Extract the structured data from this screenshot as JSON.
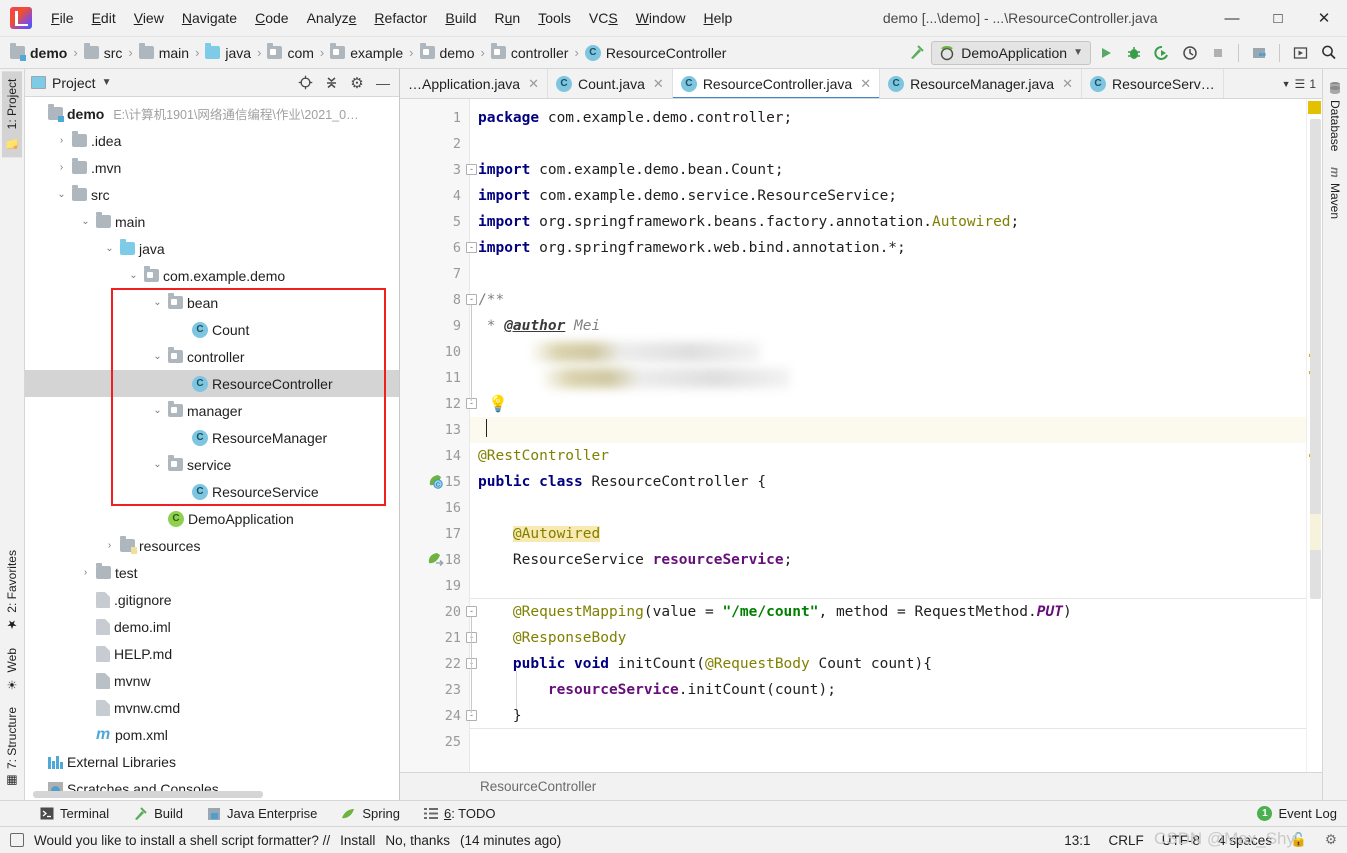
{
  "window": {
    "title": "demo [...\\demo] - ...\\ResourceController.java",
    "minimize": "—",
    "maximize": "□",
    "close": "✕",
    "logo_icon": "intellij-idea-logo"
  },
  "menu": [
    {
      "label": "File"
    },
    {
      "label": "Edit"
    },
    {
      "label": "View"
    },
    {
      "label": "Navigate"
    },
    {
      "label": "Code"
    },
    {
      "label": "Analyze"
    },
    {
      "label": "Refactor"
    },
    {
      "label": "Build"
    },
    {
      "label": "Run"
    },
    {
      "label": "Tools"
    },
    {
      "label": "VCS"
    },
    {
      "label": "Window"
    },
    {
      "label": "Help"
    }
  ],
  "navbar": {
    "breadcrumbs": [
      {
        "label": "demo",
        "icon": "project-folder-icon"
      },
      {
        "label": "src",
        "icon": "folder-icon"
      },
      {
        "label": "main",
        "icon": "folder-icon"
      },
      {
        "label": "java",
        "icon": "source-folder-icon"
      },
      {
        "label": "com",
        "icon": "package-icon"
      },
      {
        "label": "example",
        "icon": "package-icon"
      },
      {
        "label": "demo",
        "icon": "package-icon"
      },
      {
        "label": "controller",
        "icon": "package-icon"
      },
      {
        "label": "ResourceController",
        "icon": "class-icon"
      }
    ],
    "separator": "›",
    "run_config": "DemoApplication",
    "run_config_icon": "spring-boot-icon",
    "dropdown_icon": "chevron-down-icon",
    "buttons": [
      {
        "name": "make-project-button",
        "icon": "hammer-icon",
        "glyph": "↖"
      },
      {
        "name": "run-button",
        "icon": "run-icon",
        "glyph": "▶"
      },
      {
        "name": "debug-button",
        "icon": "debug-bug-icon",
        "glyph": "🐞"
      },
      {
        "name": "run-with-coverage-button",
        "icon": "coverage-icon",
        "glyph": "⮌"
      },
      {
        "name": "profile-button",
        "icon": "profiler-icon",
        "glyph": "◴"
      },
      {
        "name": "stop-button",
        "icon": "stop-square-icon",
        "glyph": "■"
      },
      {
        "name": "project-structure-button",
        "icon": "project-structure-icon",
        "glyph": "▤"
      },
      {
        "name": "updates-button",
        "icon": "update-icon",
        "glyph": "▣"
      },
      {
        "name": "search-everywhere-button",
        "icon": "search-icon",
        "glyph": "⌕"
      }
    ]
  },
  "left_strip": [
    {
      "label": "1: Project",
      "icon": "project-icon",
      "active": true
    },
    {
      "label": "2: Favorites",
      "icon": "star-icon",
      "active": false
    },
    {
      "label": "Web",
      "icon": "globe-icon",
      "active": false
    },
    {
      "label": "7: Structure",
      "icon": "structure-icon",
      "active": false
    }
  ],
  "right_strip": [
    {
      "label": "Database",
      "icon": "database-icon"
    },
    {
      "label": "Maven",
      "icon": "maven-m-icon"
    }
  ],
  "project_pane": {
    "title": "Project",
    "dropdown_icon": "chevron-down-icon",
    "actions": [
      {
        "name": "scroll-from-source-button",
        "icon": "target-icon",
        "glyph": "⊕"
      },
      {
        "name": "collapse-all-button",
        "icon": "collapse-icon",
        "glyph": "⤓"
      },
      {
        "name": "settings-button",
        "icon": "gear-icon",
        "glyph": "⚙"
      },
      {
        "name": "hide-button",
        "icon": "minimize-icon",
        "glyph": "—"
      }
    ],
    "tree": [
      {
        "label": "demo",
        "path": "E:\\计算机1901\\网络通信编程\\作业\\2021_0…",
        "indent": 0,
        "arrow": "",
        "icon": "project-folder-icon",
        "bold": true,
        "selected": false
      },
      {
        "label": ".idea",
        "path": "",
        "indent": 1,
        "arrow": "›",
        "icon": "folder-icon",
        "bold": false,
        "selected": false
      },
      {
        "label": ".mvn",
        "path": "",
        "indent": 1,
        "arrow": "›",
        "icon": "folder-icon",
        "bold": false,
        "selected": false
      },
      {
        "label": "src",
        "path": "",
        "indent": 1,
        "arrow": "⌄",
        "icon": "folder-icon",
        "bold": false,
        "selected": false
      },
      {
        "label": "main",
        "path": "",
        "indent": 2,
        "arrow": "⌄",
        "icon": "folder-icon",
        "bold": false,
        "selected": false
      },
      {
        "label": "java",
        "path": "",
        "indent": 3,
        "arrow": "⌄",
        "icon": "source-folder-icon",
        "bold": false,
        "selected": false
      },
      {
        "label": "com.example.demo",
        "path": "",
        "indent": 4,
        "arrow": "⌄",
        "icon": "package-icon",
        "bold": false,
        "selected": false
      },
      {
        "label": "bean",
        "path": "",
        "indent": 5,
        "arrow": "⌄",
        "icon": "package-icon",
        "bold": false,
        "selected": false
      },
      {
        "label": "Count",
        "path": "",
        "indent": 6,
        "arrow": "",
        "icon": "class-icon",
        "bold": false,
        "selected": false
      },
      {
        "label": "controller",
        "path": "",
        "indent": 5,
        "arrow": "⌄",
        "icon": "package-icon",
        "bold": false,
        "selected": false
      },
      {
        "label": "ResourceController",
        "path": "",
        "indent": 6,
        "arrow": "",
        "icon": "class-icon",
        "bold": false,
        "selected": true
      },
      {
        "label": "manager",
        "path": "",
        "indent": 5,
        "arrow": "⌄",
        "icon": "package-icon",
        "bold": false,
        "selected": false
      },
      {
        "label": "ResourceManager",
        "path": "",
        "indent": 6,
        "arrow": "",
        "icon": "class-icon",
        "bold": false,
        "selected": false
      },
      {
        "label": "service",
        "path": "",
        "indent": 5,
        "arrow": "⌄",
        "icon": "package-icon",
        "bold": false,
        "selected": false
      },
      {
        "label": "ResourceService",
        "path": "",
        "indent": 6,
        "arrow": "",
        "icon": "class-icon",
        "bold": false,
        "selected": false
      },
      {
        "label": "DemoApplication",
        "path": "",
        "indent": 5,
        "arrow": "",
        "icon": "spring-class-icon",
        "bold": false,
        "selected": false
      },
      {
        "label": "resources",
        "path": "",
        "indent": 3,
        "arrow": "›",
        "icon": "resources-folder-icon",
        "bold": false,
        "selected": false
      },
      {
        "label": "test",
        "path": "",
        "indent": 2,
        "arrow": "›",
        "icon": "folder-icon",
        "bold": false,
        "selected": false
      },
      {
        "label": ".gitignore",
        "path": "",
        "indent": 2,
        "arrow": "",
        "icon": "gitignore-file-icon",
        "bold": false,
        "selected": false
      },
      {
        "label": "demo.iml",
        "path": "",
        "indent": 2,
        "arrow": "",
        "icon": "iml-file-icon",
        "bold": false,
        "selected": false
      },
      {
        "label": "HELP.md",
        "path": "",
        "indent": 2,
        "arrow": "",
        "icon": "markdown-file-icon",
        "bold": false,
        "selected": false
      },
      {
        "label": "mvnw",
        "path": "",
        "indent": 2,
        "arrow": "",
        "icon": "shell-file-icon",
        "bold": false,
        "selected": false
      },
      {
        "label": "mvnw.cmd",
        "path": "",
        "indent": 2,
        "arrow": "",
        "icon": "cmd-file-icon",
        "bold": false,
        "selected": false
      },
      {
        "label": "pom.xml",
        "path": "",
        "indent": 2,
        "arrow": "",
        "icon": "maven-pom-icon",
        "bold": false,
        "selected": false
      },
      {
        "label": "External Libraries",
        "path": "",
        "indent": 0,
        "arrow": "",
        "icon": "libraries-icon",
        "bold": false,
        "selected": false
      },
      {
        "label": "Scratches and Consoles",
        "path": "",
        "indent": 0,
        "arrow": "",
        "icon": "scratches-icon",
        "bold": false,
        "selected": false
      }
    ],
    "highlight_box": {
      "first_row": 7,
      "last_row": 14,
      "color": "#f02020"
    }
  },
  "editor": {
    "tabs": [
      {
        "label": "…Application.java",
        "icon": "class-icon",
        "active": false,
        "close": "✕"
      },
      {
        "label": "Count.java",
        "icon": "class-icon",
        "active": false,
        "close": "✕"
      },
      {
        "label": "ResourceController.java",
        "icon": "class-icon",
        "active": true,
        "close": "✕"
      },
      {
        "label": "ResourceManager.java",
        "icon": "class-icon",
        "active": false,
        "close": "✕"
      },
      {
        "label": "ResourceServ…",
        "icon": "class-icon",
        "active": false,
        "close": ""
      }
    ],
    "tab_overflow": "1",
    "tab_overflow_icon": "tab-list-icon",
    "breadcrumb_bottom": "ResourceController",
    "lines": [
      {
        "n": 1,
        "tokens": [
          {
            "t": "package",
            "c": "kw"
          },
          {
            "t": " com.example.demo.controller;",
            "c": "plain"
          }
        ]
      },
      {
        "n": 2,
        "tokens": []
      },
      {
        "n": 3,
        "tokens": [
          {
            "t": "import",
            "c": "kw"
          },
          {
            "t": " com.example.demo.bean.Count;",
            "c": "plain"
          }
        ]
      },
      {
        "n": 4,
        "tokens": [
          {
            "t": "import",
            "c": "kw"
          },
          {
            "t": " com.example.demo.service.ResourceService;",
            "c": "plain"
          }
        ]
      },
      {
        "n": 5,
        "tokens": [
          {
            "t": "import",
            "c": "kw"
          },
          {
            "t": " org.springframework.beans.factory.annotation.",
            "c": "plain"
          },
          {
            "t": "Autowired",
            "c": "ann"
          },
          {
            "t": ";",
            "c": "plain"
          }
        ]
      },
      {
        "n": 6,
        "tokens": [
          {
            "t": "import",
            "c": "kw"
          },
          {
            "t": " org.springframework.web.bind.annotation.*;",
            "c": "plain"
          }
        ]
      },
      {
        "n": 7,
        "tokens": []
      },
      {
        "n": 8,
        "tokens": [
          {
            "t": "/**",
            "c": "cmt"
          }
        ]
      },
      {
        "n": 9,
        "tokens": [
          {
            "t": " * ",
            "c": "cmt"
          },
          {
            "t": "@author",
            "c": "cmt-tag"
          },
          {
            "t": " Mei",
            "c": "cmt-val"
          }
        ]
      },
      {
        "n": 10,
        "tokens": [],
        "redacted": true
      },
      {
        "n": 11,
        "tokens": [],
        "redacted": true
      },
      {
        "n": 12,
        "tokens": [],
        "bulb": true
      },
      {
        "n": 13,
        "tokens": [],
        "cursor": true
      },
      {
        "n": 14,
        "tokens": [
          {
            "t": "@RestController",
            "c": "ann"
          }
        ]
      },
      {
        "n": 15,
        "tokens": [
          {
            "t": "public class",
            "c": "kw"
          },
          {
            "t": " ResourceController {",
            "c": "plain"
          }
        ]
      },
      {
        "n": 16,
        "tokens": []
      },
      {
        "n": 17,
        "tokens": [
          {
            "t": "    ",
            "c": "plain"
          },
          {
            "t": "@Autowired",
            "c": "ann hl-aw"
          }
        ]
      },
      {
        "n": 18,
        "tokens": [
          {
            "t": "    ResourceService ",
            "c": "plain"
          },
          {
            "t": "resourceService",
            "c": "fld"
          },
          {
            "t": ";",
            "c": "plain"
          }
        ]
      },
      {
        "n": 19,
        "tokens": []
      },
      {
        "n": 20,
        "tokens": [
          {
            "t": "    ",
            "c": "plain"
          },
          {
            "t": "@RequestMapping",
            "c": "ann"
          },
          {
            "t": "(value = ",
            "c": "plain"
          },
          {
            "t": "\"/me/count\"",
            "c": "str"
          },
          {
            "t": ", method = RequestMethod.",
            "c": "plain"
          },
          {
            "t": "PUT",
            "c": "stat"
          },
          {
            "t": ")",
            "c": "plain"
          }
        ]
      },
      {
        "n": 21,
        "tokens": [
          {
            "t": "    ",
            "c": "plain"
          },
          {
            "t": "@ResponseBody",
            "c": "ann"
          }
        ]
      },
      {
        "n": 22,
        "tokens": [
          {
            "t": "    ",
            "c": "plain"
          },
          {
            "t": "public void",
            "c": "kw"
          },
          {
            "t": " initCount(",
            "c": "plain"
          },
          {
            "t": "@RequestBody",
            "c": "ann"
          },
          {
            "t": " Count count){",
            "c": "plain"
          }
        ]
      },
      {
        "n": 23,
        "tokens": [
          {
            "t": "        ",
            "c": "plain"
          },
          {
            "t": "resourceService",
            "c": "fld"
          },
          {
            "t": ".initCount(count);",
            "c": "plain"
          }
        ]
      },
      {
        "n": 24,
        "tokens": [
          {
            "t": "    }",
            "c": "plain"
          }
        ]
      },
      {
        "n": 25,
        "tokens": []
      }
    ],
    "gutter_glyphs": [
      {
        "line": 15,
        "icon": "spring-bean-icon"
      },
      {
        "line": 18,
        "icon": "spring-autowired-icon"
      }
    ],
    "bulb_icon": "intention-bulb-icon"
  },
  "toolstrip": {
    "items": [
      {
        "label": "Terminal",
        "icon": "terminal-icon",
        "glyph": "⌨"
      },
      {
        "label": "Build",
        "icon": "hammer-icon",
        "glyph": "↖"
      },
      {
        "label": "Java Enterprise",
        "icon": "java-enterprise-icon",
        "glyph": "▤"
      },
      {
        "label": "Spring",
        "icon": "spring-leaf-icon",
        "glyph": "❦"
      },
      {
        "label": "6: TODO",
        "icon": "todo-list-icon",
        "glyph": "☰"
      }
    ],
    "event_log": "Event Log",
    "event_log_count": "1",
    "event_log_icon": "event-log-icon"
  },
  "statusbar": {
    "message_icon": "notification-icon",
    "message": "Would you like to install a shell script formatter? //",
    "action_install": "Install",
    "action_dismiss": "No, thanks",
    "timestamp": "(14 minutes ago)",
    "caret_position": "13:1",
    "line_separator": "CRLF",
    "encoding": "UTF-8",
    "indent": "4 spaces",
    "lock_icon": "lock-icon",
    "inspection_icon": "inspections-icon"
  },
  "watermark": "CSDN @Max_Shy"
}
